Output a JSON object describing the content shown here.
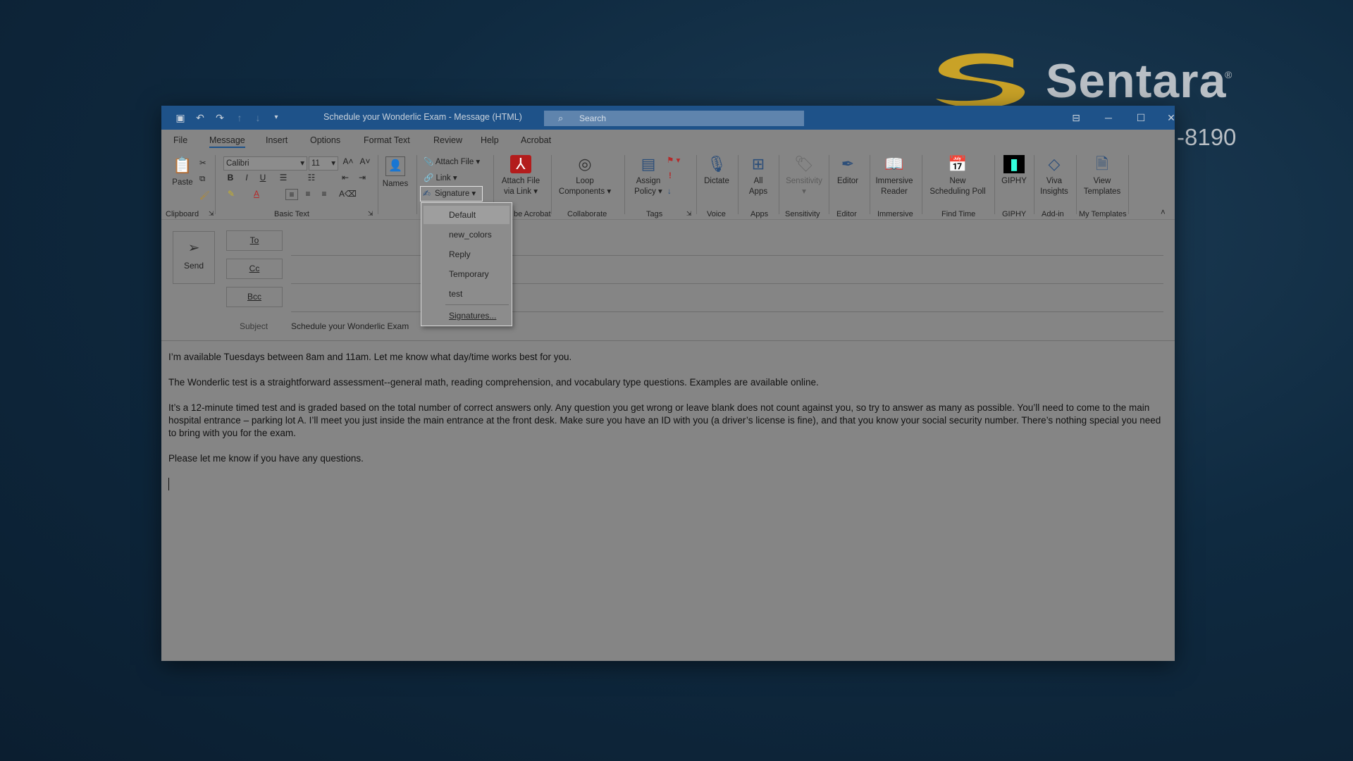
{
  "background": {
    "brand_name": "Sentara",
    "brand_mark": "®",
    "phone_fragment": "-8190"
  },
  "titlebar": {
    "title": "Schedule your Wonderlic Exam  -  Message (HTML)",
    "search_placeholder": "Search"
  },
  "tabs": [
    "File",
    "Message",
    "Insert",
    "Options",
    "Format Text",
    "Review",
    "Help",
    "Acrobat"
  ],
  "active_tab": "Message",
  "ribbon": {
    "paste": "Paste",
    "font_name": "Calibri",
    "font_size": "11",
    "names": "Names",
    "attach_file": "Attach File",
    "link": "Link",
    "signature": "Signature",
    "attach_via_link_1": "Attach File",
    "attach_via_link_2": "via Link",
    "loop_1": "Loop",
    "loop_2": "Components",
    "assign_1": "Assign",
    "assign_2": "Policy",
    "dictate": "Dictate",
    "all_apps_1": "All",
    "all_apps_2": "Apps",
    "sensitivity": "Sensitivity",
    "editor": "Editor",
    "immersive_1": "Immersive",
    "immersive_2": "Reader",
    "poll_1": "New",
    "poll_2": "Scheduling Poll",
    "giphy": "GIPHY",
    "viva_1": "Viva",
    "viva_2": "Insights",
    "templates_1": "View",
    "templates_2": "Templates",
    "groups": {
      "clipboard": "Clipboard",
      "basic_text": "Basic Text",
      "adobe_acrobat_partial": "be Acrobat",
      "collaborate": "Collaborate",
      "tags": "Tags",
      "voice": "Voice",
      "apps": "Apps",
      "sensitivity": "Sensitivity",
      "editor": "Editor",
      "immersive": "Immersive",
      "find_time": "Find Time",
      "giphy": "GIPHY",
      "add_in": "Add-in",
      "my_templates": "My Templates"
    }
  },
  "signature_menu": {
    "items": [
      "Default",
      "new_colors",
      "Reply",
      "Temporary",
      "test"
    ],
    "manage": "Signatures..."
  },
  "compose": {
    "send": "Send",
    "to": "To",
    "cc": "Cc",
    "bcc": "Bcc",
    "subject_label": "Subject",
    "subject_value": "Schedule your Wonderlic Exam"
  },
  "body": {
    "p1": "I’m available Tuesdays between 8am and 11am. Let me know what day/time works best for you.",
    "p2": "The Wonderlic test is a straightforward assessment--general math, reading comprehension, and vocabulary type questions. Examples are available online.",
    "p3": "It’s a 12-minute timed test and is graded based on the total number of correct answers only. Any question you get wrong or leave blank does not count against you, so try to answer as many as possible. You’ll need to come to the main hospital entrance – parking lot A. I’ll meet you just inside the main entrance at the front desk. Make sure you have an ID with you (a driver’s license is fine), and that you know your social security number. There’s nothing special you need to bring with you for the exam.",
    "p4": "Please let me know if you have any questions."
  }
}
